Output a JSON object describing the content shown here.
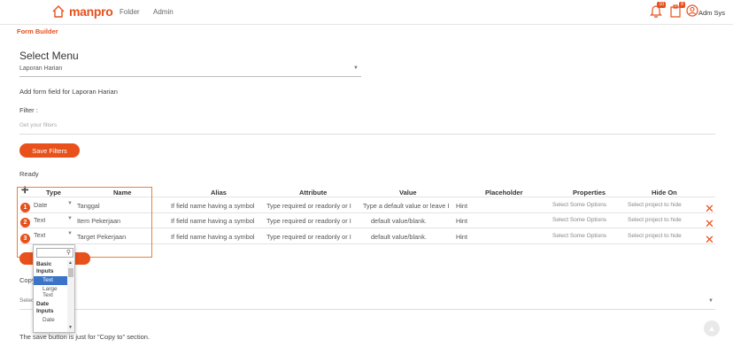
{
  "topbar": {
    "logo_text": "manpro",
    "nav": [
      "Folder",
      "Admin"
    ],
    "notif_badge_1": "10",
    "notif_badge_2": "8",
    "user_name": "Adm Sys"
  },
  "page": {
    "title": "Form Builder",
    "select_menu_heading": "Select Menu",
    "selected_menu": "Laporan Harian",
    "add_form_label": "Add form field for Laporan Harian",
    "filter_label": "Filter :",
    "filter_placeholder": "Get your filters",
    "save_filters_label": "Save Filters",
    "status": "Ready"
  },
  "table": {
    "headers": [
      "Type",
      "Name",
      "Alias",
      "Attribute",
      "Value",
      "Placeholder",
      "Properties",
      "Hide On"
    ],
    "rows": [
      {
        "num": "1",
        "type": "Date",
        "name": "Tanggal",
        "alias": "If field name having a symbol",
        "attribute": "Type required or readonly or I",
        "value": "Type a default value or leave I",
        "placeholder": "Hint",
        "properties": "Select Some Options",
        "hide_on": "Select project to hide"
      },
      {
        "num": "2",
        "type": "Text",
        "name": "Item Pekerjaan",
        "alias": "If field name having a symbol",
        "attribute": "Type required or readonly or I",
        "value": "default value/blank.",
        "placeholder": "Hint",
        "properties": "Select Some Options",
        "hide_on": "Select project to hide"
      },
      {
        "num": "3",
        "type": "Text",
        "name": "Target Pekerjaan",
        "alias": "If field name having a symbol",
        "attribute": "Type required or readonly or I",
        "value": "default value/blank.",
        "placeholder": "Hint",
        "properties": "Select Some Options",
        "hide_on": "Select project to hide"
      }
    ]
  },
  "dropdown": {
    "groups": [
      {
        "label": "Basic Inputs",
        "options": [
          "Text",
          "Large Text"
        ]
      },
      {
        "label": "Date Inputs",
        "options": [
          "Date"
        ]
      }
    ],
    "selected": "Text"
  },
  "copy": {
    "label": "Copy",
    "select_placeholder": "Selec",
    "footer_note": "The save button is just for \"Copy to\" section."
  },
  "colors": {
    "accent": "#e8501c",
    "selected_option": "#3b73c8"
  }
}
